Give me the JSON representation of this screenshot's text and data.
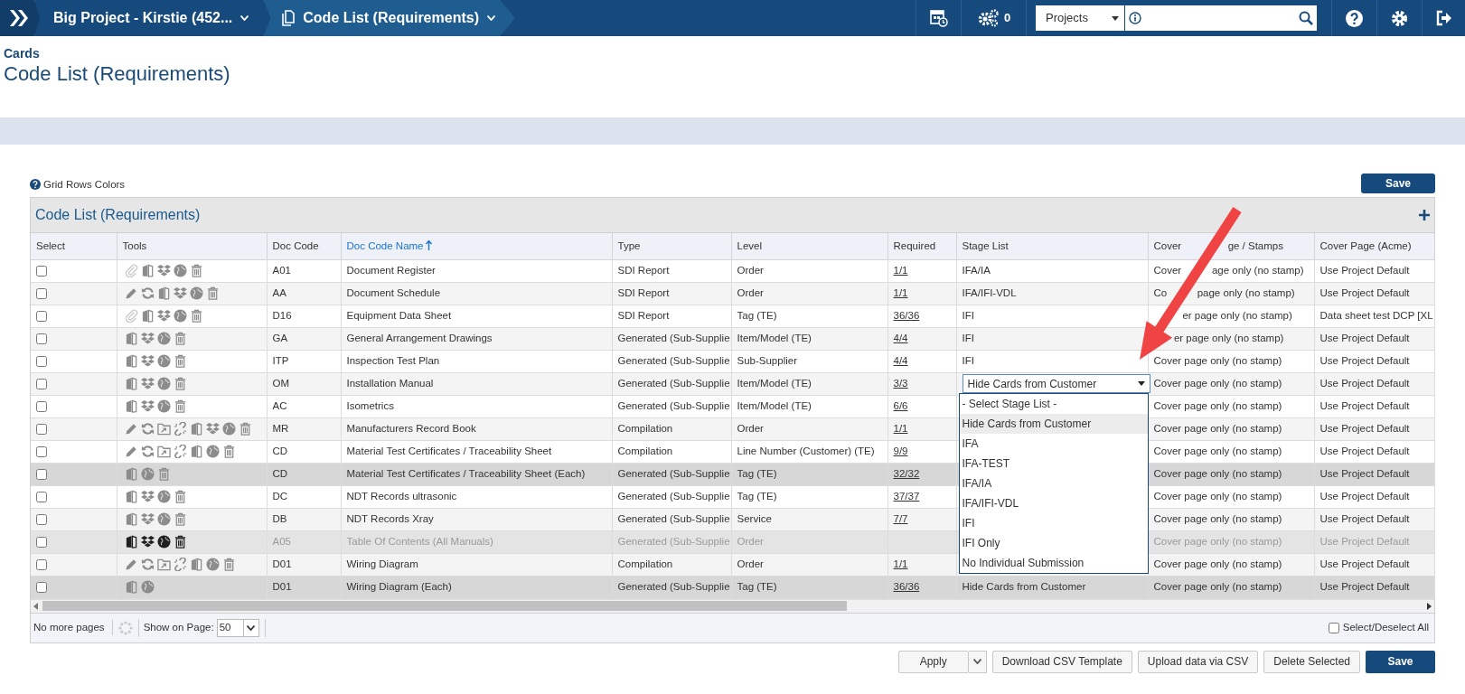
{
  "nav": {
    "breadcrumbs": [
      {
        "label": "Big Project - Kirstie (452...",
        "kind": "project"
      },
      {
        "label": "Code List (Requirements)",
        "kind": "page"
      }
    ],
    "jobs_count": "0",
    "scope_select": "Projects"
  },
  "page": {
    "section": "Cards",
    "title": "Code List (Requirements)"
  },
  "grid_rows_colors": "Grid Rows Colors",
  "save_top": "Save",
  "panel": {
    "title": "Code List (Requirements)",
    "columns": [
      {
        "label": "Select",
        "sorted": false
      },
      {
        "label": "Tools",
        "sorted": false
      },
      {
        "label": "Doc Code",
        "sorted": false
      },
      {
        "label": "Doc Code Name",
        "sorted": true
      },
      {
        "label": "Type",
        "sorted": false
      },
      {
        "label": "Level",
        "sorted": false
      },
      {
        "label": "Required",
        "sorted": false
      },
      {
        "label": "Stage List",
        "sorted": false
      },
      {
        "label": [
          "Cover",
          "ge / Stamps"
        ],
        "sorted": false
      },
      {
        "label": "Cover Page (Acme)",
        "sorted": false
      }
    ],
    "rows": [
      {
        "kind": "plain",
        "checked": false,
        "tools": [
          {
            "kind": "paperclip"
          },
          {
            "kind": "book"
          },
          {
            "kind": "box"
          },
          {
            "kind": "globe"
          },
          {
            "kind": "trash"
          }
        ],
        "code": "A01",
        "name": "Document Register",
        "type": "SDI Report",
        "level": "Order",
        "required": "1/1",
        "stage": "IFA/IA",
        "cover_stamps": [
          "Cover",
          "age only (no stamp)"
        ],
        "cover_acme": "Use Project Default"
      },
      {
        "kind": "plain",
        "checked": false,
        "tools": [
          {
            "kind": "pencil"
          },
          {
            "kind": "refresh"
          },
          {
            "kind": "book"
          },
          {
            "kind": "box"
          },
          {
            "kind": "globe"
          },
          {
            "kind": "trash"
          }
        ],
        "code": "AA",
        "name": "Document Schedule",
        "type": "SDI Report",
        "level": "Order",
        "required": "1/1",
        "stage": "IFA/IFI-VDL",
        "cover_stamps": [
          "Co",
          "page only (no stamp)"
        ],
        "cover_acme": "Use Project Default"
      },
      {
        "kind": "plain",
        "checked": false,
        "tools": [
          {
            "kind": "paperclip"
          },
          {
            "kind": "book"
          },
          {
            "kind": "box"
          },
          {
            "kind": "globe"
          },
          {
            "kind": "trash"
          }
        ],
        "code": "D16",
        "name": "Equipment Data Sheet",
        "type": "SDI Report",
        "level": "Tag (TE)",
        "required": "36/36",
        "stage": "IFI",
        "cover_stamps": [
          "er page only (no stamp)"
        ],
        "cover_acme": "Data sheet test DCP [XL"
      },
      {
        "kind": "plain",
        "checked": false,
        "tools": [
          {
            "kind": "book"
          },
          {
            "kind": "box"
          },
          {
            "kind": "globe"
          },
          {
            "kind": "trash"
          }
        ],
        "code": "GA",
        "name": "General Arrangement Drawings",
        "type": "Generated (Sub-Supplie",
        "level": "Item/Model (TE)",
        "required": "4/4",
        "stage": "IFI",
        "cover_stamps": [
          "er page only (no stamp)"
        ],
        "cover_acme": "Use Project Default"
      },
      {
        "kind": "plain",
        "checked": false,
        "tools": [
          {
            "kind": "book"
          },
          {
            "kind": "box"
          },
          {
            "kind": "globe"
          },
          {
            "kind": "trash"
          }
        ],
        "code": "ITP",
        "name": "Inspection Test Plan",
        "type": "Generated (Sub-Supplie",
        "level": "Sub-Supplier",
        "required": "4/4",
        "stage": "IFI",
        "cover_stamps": "Cover page only (no stamp)",
        "cover_acme": "Use Project Default"
      },
      {
        "kind": "plain",
        "checked": false,
        "tools": [
          {
            "kind": "book"
          },
          {
            "kind": "box"
          },
          {
            "kind": "globe"
          },
          {
            "kind": "trash"
          }
        ],
        "code": "OM",
        "name": "Installation Manual",
        "type": "Generated (Sub-Supplie",
        "level": "Item/Model (TE)",
        "required": "3/3",
        "stage_select": {
          "value": "Hide Cards from Customer",
          "expanded": true,
          "options": [
            {
              "label": "- Select Stage List -",
              "selected": false
            },
            {
              "label": "Hide Cards from Customer",
              "selected": true
            },
            {
              "label": "IFA",
              "selected": false
            },
            {
              "label": "IFA-TEST",
              "selected": false
            },
            {
              "label": "IFA/IA",
              "selected": false
            },
            {
              "label": "IFA/IFI-VDL",
              "selected": false
            },
            {
              "label": "IFI",
              "selected": false
            },
            {
              "label": "IFI Only",
              "selected": false
            },
            {
              "label": "No Individual Submission",
              "selected": false
            }
          ]
        },
        "cover_stamps": "Cover page only (no stamp)",
        "cover_acme": "Use Project Default"
      },
      {
        "kind": "plain",
        "checked": false,
        "tools": [
          {
            "kind": "book"
          },
          {
            "kind": "box"
          },
          {
            "kind": "globe"
          },
          {
            "kind": "trash"
          }
        ],
        "code": "AC",
        "name": "Isometrics",
        "type": "Generated (Sub-Supplie",
        "level": "Item/Model (TE)",
        "required": "6/6",
        "cover_stamps": "Cover page only (no stamp)",
        "cover_acme": "Use Project Default"
      },
      {
        "kind": "plain",
        "checked": false,
        "tools": [
          {
            "kind": "pencil"
          },
          {
            "kind": "refresh"
          },
          {
            "kind": "folder"
          },
          {
            "kind": "unlink"
          },
          {
            "kind": "book"
          },
          {
            "kind": "box"
          },
          {
            "kind": "globe"
          },
          {
            "kind": "trash"
          }
        ],
        "code": "MR",
        "name": "Manufacturers Record Book",
        "type": "Compilation",
        "level": "Order",
        "required": "1/1",
        "cover_stamps": "Cover page only (no stamp)",
        "cover_acme": "Use Project Default"
      },
      {
        "kind": "plain",
        "checked": false,
        "tools": [
          {
            "kind": "pencil"
          },
          {
            "kind": "refresh"
          },
          {
            "kind": "folder"
          },
          {
            "kind": "unlink"
          },
          {
            "kind": "book"
          },
          {
            "kind": "globe"
          },
          {
            "kind": "trash"
          }
        ],
        "code": "CD",
        "name": "Material Test Certificates / Traceability Sheet",
        "type": "Compilation",
        "level": "Line Number (Customer) (TE)",
        "required": "9/9",
        "cover_stamps": "Cover page only (no stamp)",
        "cover_acme": "Use Project Default"
      },
      {
        "kind": "each",
        "checked": false,
        "tools": [
          {
            "kind": "book"
          },
          {
            "kind": "globe"
          },
          {
            "kind": "trash"
          }
        ],
        "code": "CD",
        "name": "Material Test Certificates / Traceability Sheet (Each)",
        "type": "Generated (Sub-Supplie",
        "level": "Tag (TE)",
        "required": "32/32",
        "cover_stamps": "Cover page only (no stamp)",
        "cover_acme": "Use Project Default"
      },
      {
        "kind": "plain",
        "checked": false,
        "tools": [
          {
            "kind": "book"
          },
          {
            "kind": "box"
          },
          {
            "kind": "globe"
          },
          {
            "kind": "trash"
          }
        ],
        "code": "DC",
        "name": "NDT Records ultrasonic",
        "type": "Generated (Sub-Supplie",
        "level": "Tag (TE)",
        "required": "37/37",
        "cover_stamps": "Cover page only (no stamp)",
        "cover_acme": "Use Project Default"
      },
      {
        "kind": "plain",
        "checked": false,
        "tools": [
          {
            "kind": "book"
          },
          {
            "kind": "box"
          },
          {
            "kind": "globe"
          },
          {
            "kind": "trash"
          }
        ],
        "code": "DB",
        "name": "NDT Records Xray",
        "type": "Generated (Sub-Supplie",
        "level": "Service",
        "required": "7/7",
        "cover_stamps": "Cover page only (no stamp)",
        "cover_acme": "Use Project Default"
      },
      {
        "kind": "inactive",
        "checked": false,
        "tools": [
          {
            "kind": "book"
          },
          {
            "kind": "box"
          },
          {
            "kind": "globe"
          },
          {
            "kind": "trash"
          }
        ],
        "code": "A05",
        "name": "Table Of Contents (All Manuals)",
        "type": "Generated (Sub-Supplie",
        "level": "Order",
        "cover_stamps": "Cover page only (no stamp)",
        "cover_acme": "Use Project Default"
      },
      {
        "kind": "plain",
        "checked": false,
        "tools": [
          {
            "kind": "pencil"
          },
          {
            "kind": "refresh"
          },
          {
            "kind": "folder"
          },
          {
            "kind": "unlink"
          },
          {
            "kind": "book"
          },
          {
            "kind": "globe"
          },
          {
            "kind": "trash"
          }
        ],
        "code": "D01",
        "name": "Wiring Diagram",
        "type": "Compilation",
        "level": "Order",
        "required": "1/1",
        "cover_stamps": "Cover page only (no stamp)",
        "cover_acme": "Use Project Default"
      },
      {
        "kind": "each",
        "checked": false,
        "tools": [
          {
            "kind": "book"
          },
          {
            "kind": "globe"
          }
        ],
        "code": "D01",
        "name": "Wiring Diagram (Each)",
        "type": "Generated (Sub-Supplie",
        "level": "Tag (TE)",
        "required": "36/36",
        "stage": "Hide Cards from Customer",
        "cover_stamps": "Cover page only (no stamp)",
        "cover_acme": "Use Project Default"
      }
    ],
    "footer": {
      "pages": "No more pages",
      "show_label": "Show on Page:",
      "page_size": "50",
      "select_all": {
        "label": "Select/Deselect All",
        "checked": false
      }
    }
  },
  "actions": [
    "Apply",
    "Download CSV Template",
    "Upload data via CSV",
    "Delete Selected",
    "Save"
  ]
}
